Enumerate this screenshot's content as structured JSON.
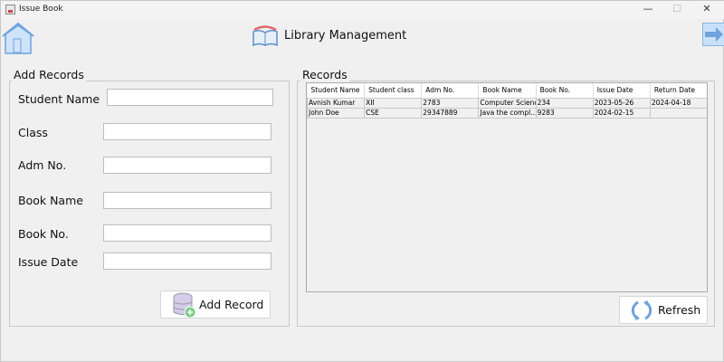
{
  "window": {
    "title": "Issue Book",
    "minimize": "—",
    "maximize": "☐",
    "close": "✕"
  },
  "header": {
    "title": "Library Management"
  },
  "add_records": {
    "legend": "Add Records",
    "fields": [
      {
        "label": "Student Name",
        "value": ""
      },
      {
        "label": "Class",
        "value": ""
      },
      {
        "label": "Adm No.",
        "value": ""
      },
      {
        "label": "Book Name",
        "value": ""
      },
      {
        "label": "Book No.",
        "value": ""
      },
      {
        "label": "Issue Date",
        "value": ""
      }
    ],
    "button": "Add Record"
  },
  "records": {
    "legend": "Records",
    "columns": [
      "Student Name",
      "Student class",
      "Adm No.",
      "Book Name",
      "Book No.",
      "Issue Date",
      "Return Date"
    ],
    "rows": [
      [
        "Avnish Kumar",
        "XII",
        "2783",
        "Computer Science",
        "234",
        "2023-05-26",
        "2024-04-18"
      ],
      [
        "John Doe",
        "CSE",
        "29347889",
        "Java the compl...",
        "9283",
        "2024-02-15",
        ""
      ]
    ],
    "button": "Refresh"
  },
  "colors": {
    "accent": "#6fa3dc",
    "text": "#111111"
  }
}
